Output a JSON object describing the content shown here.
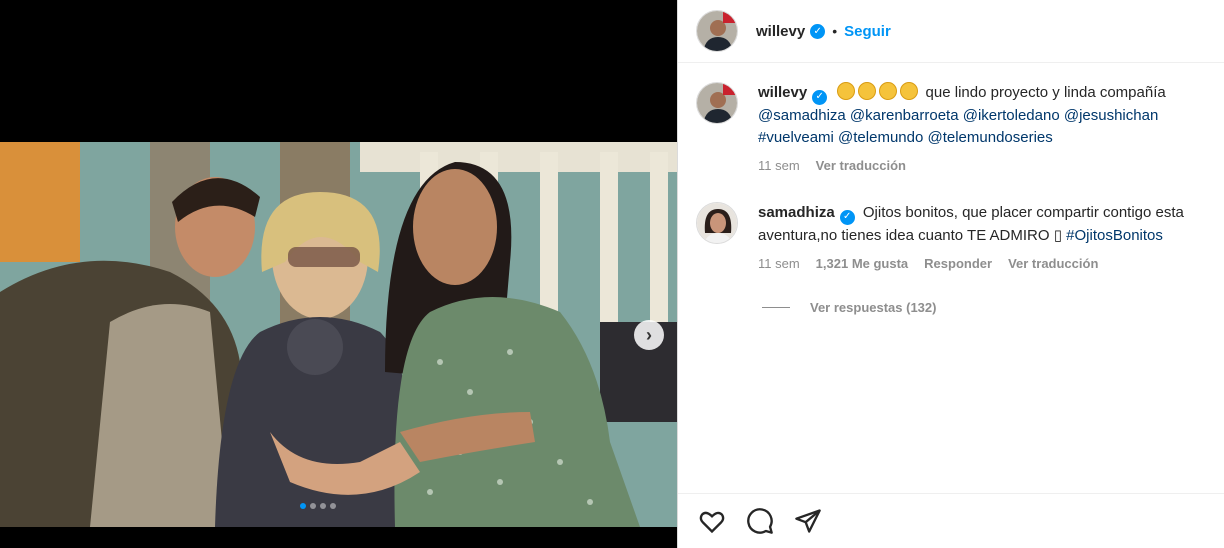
{
  "post": {
    "author": "willevy",
    "follow_label": "Seguir",
    "separator": "•",
    "next_label": "›",
    "carousel": {
      "count": 4,
      "active": 0
    }
  },
  "caption": {
    "username": "willevy",
    "text": "que lindo proyecto y linda compañía",
    "mentions_line1": "@samadhiza @karenbarroeta @ikertoledano @jesushichan",
    "mentions_line2": "#vuelveami @telemundo @telemundoseries",
    "time": "11 sem",
    "translate": "Ver traducción"
  },
  "comment": {
    "username": "samadhiza",
    "text": "Ojitos bonitos, que placer compartir contigo esta",
    "text2": "aventura,no tienes idea cuanto TE ADMIRO ▯",
    "hashtag": "#OjitosBonitos",
    "time": "11 sem",
    "likes": "1,321 Me gusta",
    "reply": "Responder",
    "translate": "Ver traducción"
  },
  "replies_label": "Ver respuestas (132)",
  "colors": {
    "accent": "#0095f6",
    "mention": "#00376b",
    "muted": "#8e8e8e"
  },
  "icons": [
    "verified-icon",
    "heart-icon",
    "comment-icon",
    "share-icon",
    "chevron-right-icon"
  ]
}
